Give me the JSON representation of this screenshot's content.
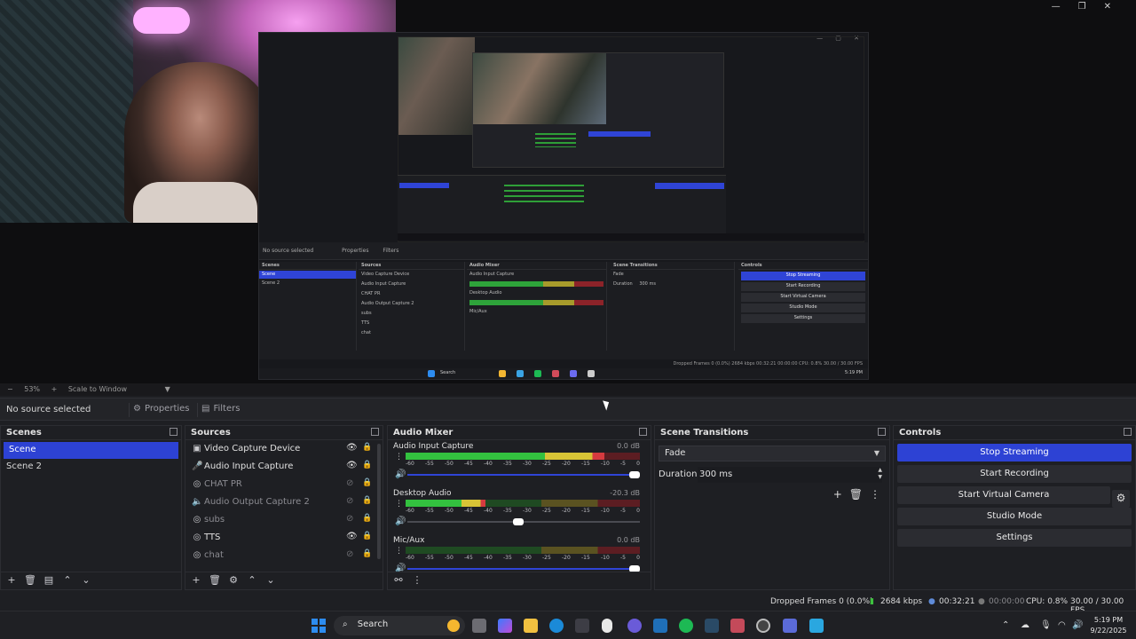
{
  "preview": {
    "nested": {
      "no_source": "No source selected",
      "properties": "Properties",
      "filters": "Filters",
      "scenes_title": "Scenes",
      "sources_title": "Sources",
      "mixer_title": "Audio Mixer",
      "transitions_title": "Scene Transitions",
      "controls_title": "Controls",
      "scenes": [
        "Scene",
        "Scene 2"
      ],
      "sources": [
        "Video Capture Device",
        "Audio Input Capture",
        "CHAT PR",
        "Audio Output Capture 2",
        "subs",
        "TTS",
        "chat"
      ],
      "channels": [
        "Audio Input Capture",
        "Desktop Audio",
        "Mic/Aux"
      ],
      "fade": "Fade",
      "duration_label": "Duration",
      "duration_value": "300 ms",
      "buttons": [
        "Stop Streaming",
        "Start Recording",
        "Start Virtual Camera",
        "Studio Mode",
        "Settings"
      ],
      "status": "Dropped Frames 0 (0.0%)   2684 kbps   00:32:21   00:00:00   CPU: 0.8%   30.00 / 30.00 FPS",
      "search": "Search",
      "clock": "5:19 PM"
    }
  },
  "zoombar": {
    "minus": "−",
    "zoom": "53%",
    "plus": "+",
    "mode": "Scale to Window",
    "arrow": "▼"
  },
  "sourcebar": {
    "no_source": "No source selected",
    "properties": "Properties",
    "filters": "Filters"
  },
  "scenes": {
    "title": "Scenes",
    "items": [
      {
        "label": "Scene",
        "selected": true
      },
      {
        "label": "Scene 2",
        "selected": false
      }
    ]
  },
  "sources": {
    "title": "Sources",
    "items": [
      {
        "label": "Video Capture Device",
        "icon": "camera-icon",
        "visible": true
      },
      {
        "label": "Audio Input Capture",
        "icon": "microphone-icon",
        "visible": true
      },
      {
        "label": "CHAT PR",
        "icon": "browser-icon",
        "visible": false
      },
      {
        "label": "Audio Output Capture 2",
        "icon": "speaker-icon",
        "visible": false
      },
      {
        "label": "subs",
        "icon": "browser-icon",
        "visible": false
      },
      {
        "label": "TTS",
        "icon": "browser-icon",
        "visible": true
      },
      {
        "label": "chat",
        "icon": "browser-icon",
        "visible": false
      }
    ]
  },
  "mixer": {
    "title": "Audio Mixer",
    "ticks": [
      "-60",
      "-55",
      "-50",
      "-45",
      "-40",
      "-35",
      "-30",
      "-25",
      "-20",
      "-15",
      "-10",
      "-5",
      "0"
    ],
    "channels": [
      {
        "name": "Audio Input Capture",
        "db": "0.0 dB",
        "level": 0.85,
        "volume": 1.0
      },
      {
        "name": "Desktop Audio",
        "db": "-20.3 dB",
        "level": 0.34,
        "volume": 0.5
      },
      {
        "name": "Mic/Aux",
        "db": "0.0 dB",
        "level": 0.0,
        "volume": 1.0
      }
    ]
  },
  "transitions": {
    "title": "Scene Transitions",
    "selected": "Fade",
    "duration_label": "Duration",
    "duration_value": "300 ms"
  },
  "controls": {
    "title": "Controls",
    "stop_streaming": "Stop Streaming",
    "start_recording": "Start Recording",
    "start_virtual_camera": "Start Virtual Camera",
    "studio_mode": "Studio Mode",
    "settings": "Settings"
  },
  "status": {
    "dropped": "Dropped Frames 0 (0.0%)",
    "bitrate": "2684 kbps",
    "stream_time": "00:32:21",
    "rec_time": "00:00:00",
    "cpu": "CPU: 0.8%",
    "fps": "30.00 / 30.00 FPS"
  },
  "taskbar": {
    "search": "Search",
    "time": "5:19 PM",
    "date": "9/22/2025"
  },
  "colors": {
    "accent": "#2d42d4",
    "meter_green": "#33c13f",
    "meter_yellow": "#d8c436",
    "meter_red": "#d63a3f"
  }
}
